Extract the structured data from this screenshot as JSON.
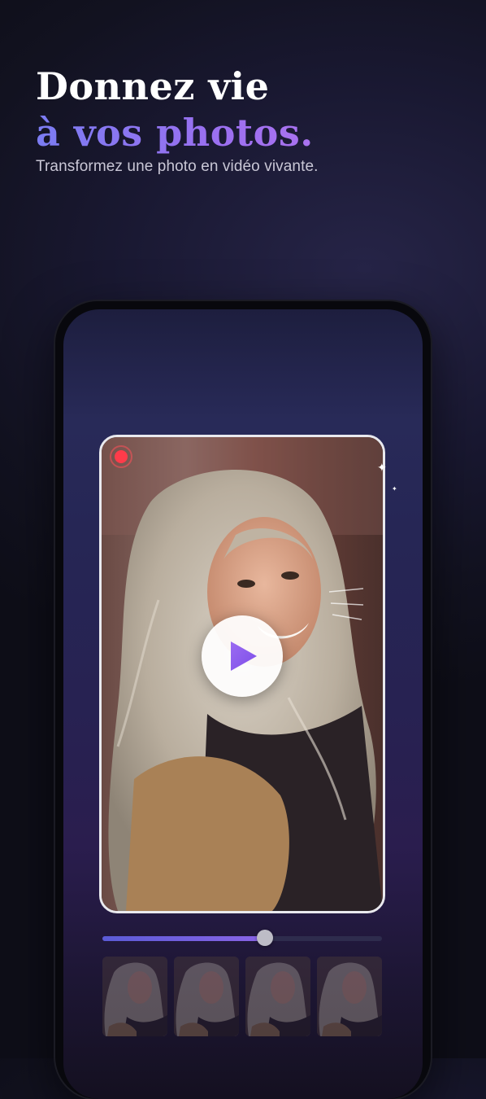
{
  "hero": {
    "title_line1": "Donnez vie",
    "title_line2": "à vos photos.",
    "subtitle": "Transformez une photo en vidéo vivante."
  },
  "player": {
    "recording_indicator": "record-icon",
    "play_icon": "play-icon",
    "progress": 0.58
  },
  "filmstrip": {
    "frame_count": 4
  },
  "colors": {
    "accent_purple": "#8b5cf6",
    "record_red": "#ff3b4a",
    "title_white": "#ffffff",
    "subtitle_gray": "#c9c7d6"
  }
}
